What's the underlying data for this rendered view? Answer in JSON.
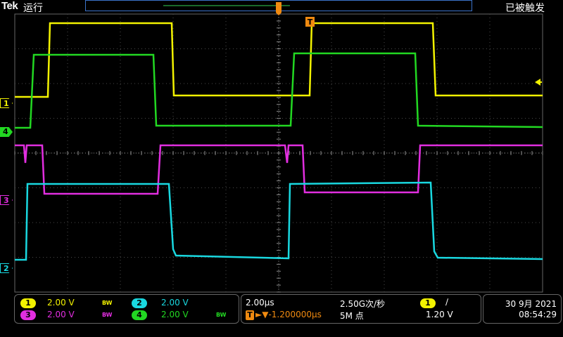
{
  "header": {
    "brand": "Tek",
    "run_state": "运行",
    "trigger_state": "已被触发"
  },
  "colors": {
    "ch1": "#f2f200",
    "ch2": "#19d8e0",
    "ch3": "#e22ee0",
    "ch4": "#22d822",
    "trigger": "#f08a10",
    "grid": "#5a5a5a"
  },
  "channels": {
    "ch1": {
      "label": "1",
      "scale": "2.00 V",
      "bw": "BW"
    },
    "ch2": {
      "label": "2",
      "scale": "2.00 V",
      "bw": ""
    },
    "ch3": {
      "label": "3",
      "scale": "2.00 V",
      "bw": "BW"
    },
    "ch4": {
      "label": "4",
      "scale": "2.00 V",
      "bw": "BW"
    }
  },
  "timebase": {
    "scale": "2.00μs",
    "sample_rate": "2.50G次/秒",
    "position": "►▼-1.200000μs",
    "record_length": "5M 点"
  },
  "trigger": {
    "source": "1",
    "slope": "∕",
    "level": "1.20 V",
    "marker_label": "T"
  },
  "datetime": {
    "date": "30 9月 2021",
    "time": "08:54:29"
  }
}
